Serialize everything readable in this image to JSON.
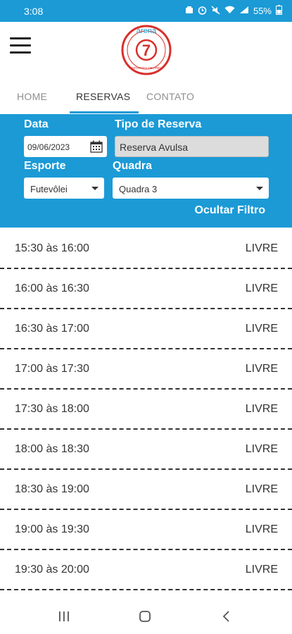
{
  "status": {
    "time": "3:08",
    "battery": "55%"
  },
  "header": {
    "logo_text_top": "arena",
    "logo_number": "7",
    "logo_text_bottom": "ESPORTES DE AREIA"
  },
  "tabs": [
    {
      "label": "HOME"
    },
    {
      "label": "RESERVAS"
    },
    {
      "label": "CONTATO"
    }
  ],
  "filter": {
    "date_label": "Data",
    "date_value": "09/06/2023",
    "type_label": "Tipo de Reserva",
    "type_value": "Reserva Avulsa",
    "sport_label": "Esporte",
    "sport_value": "Futevôlei",
    "court_label": "Quadra",
    "court_value": "Quadra 3",
    "hide_label": "Ocultar Filtro"
  },
  "slots": [
    {
      "time": "15:30 às 16:00",
      "status": "LIVRE"
    },
    {
      "time": "16:00 às 16:30",
      "status": "LIVRE"
    },
    {
      "time": "16:30 às 17:00",
      "status": "LIVRE"
    },
    {
      "time": "17:00 às 17:30",
      "status": "LIVRE"
    },
    {
      "time": "17:30 às 18:00",
      "status": "LIVRE"
    },
    {
      "time": "18:00 às 18:30",
      "status": "LIVRE"
    },
    {
      "time": "18:30 às 19:00",
      "status": "LIVRE"
    },
    {
      "time": "19:00 às 19:30",
      "status": "LIVRE"
    },
    {
      "time": "19:30 às 20:00",
      "status": "LIVRE"
    }
  ],
  "colors": {
    "primary": "#1b9ad6",
    "logo_red": "#d8302b"
  },
  "icons": [
    "hamburger-menu-icon",
    "calendar-icon",
    "chevron-down-icon",
    "recent-apps-icon",
    "home-icon",
    "back-icon"
  ]
}
